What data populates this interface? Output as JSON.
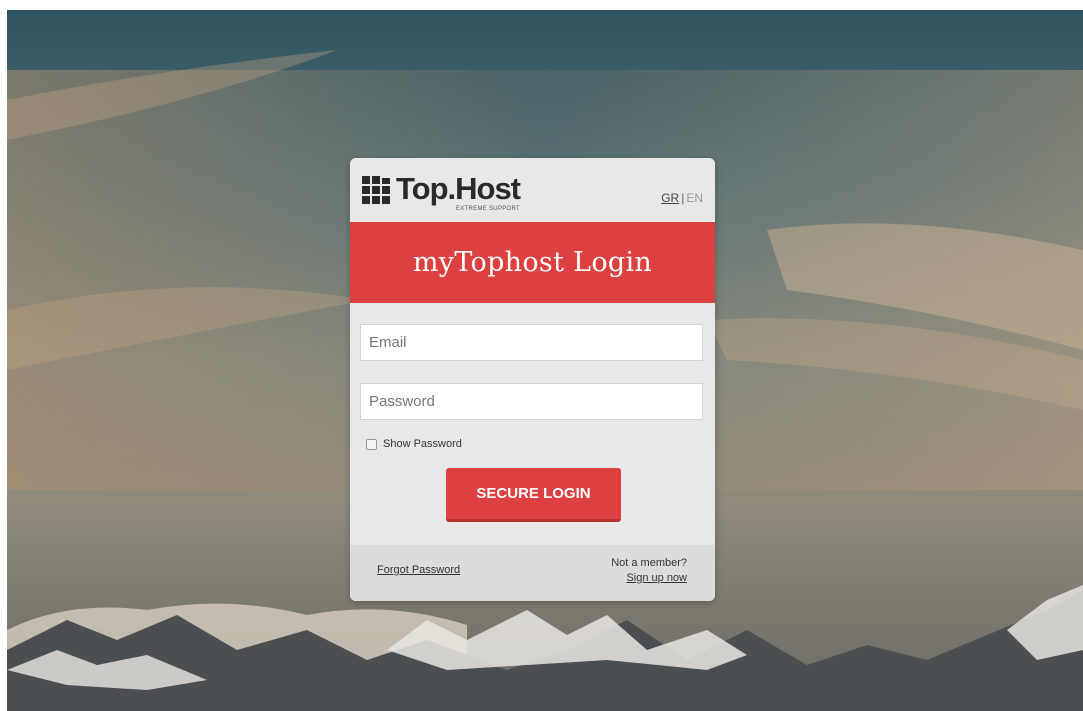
{
  "brand": {
    "name": "Top.Host",
    "tagline": "EXTREME SUPPORT"
  },
  "language": {
    "gr": "GR",
    "separator": "|",
    "en": "EN"
  },
  "banner": {
    "title": "myTophost Login"
  },
  "form": {
    "email_placeholder": "Email",
    "password_placeholder": "Password",
    "show_password_label": "Show Password",
    "submit_label": "SECURE LOGIN"
  },
  "footer": {
    "forgot_label": "Forgot Password",
    "not_member_label": "Not a member?",
    "signup_label": "Sign up now"
  },
  "colors": {
    "accent": "#dc4040",
    "card_bg": "#e8e8e8",
    "footer_bg": "#dcdcdc"
  },
  "icons": {
    "logo": "grid-logo-icon",
    "checkbox": "checkbox-unchecked"
  }
}
